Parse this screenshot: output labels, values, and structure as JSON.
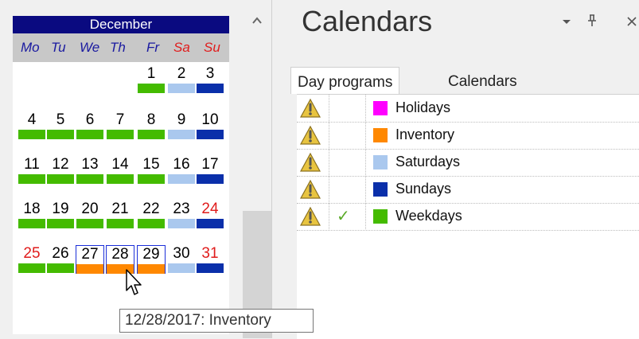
{
  "calendar": {
    "month": "December",
    "weekdays": [
      {
        "label": "Mo",
        "red": false
      },
      {
        "label": "Tu",
        "red": false
      },
      {
        "label": "We",
        "red": false
      },
      {
        "label": "Th",
        "red": false
      },
      {
        "label": "Fr",
        "red": false
      },
      {
        "label": "Sa",
        "red": true
      },
      {
        "label": "Su",
        "red": true
      }
    ],
    "days": [
      {
        "day": "1",
        "col": 4,
        "week": 0,
        "color": "#44bb00",
        "red": false,
        "selected": false
      },
      {
        "day": "2",
        "col": 5,
        "week": 0,
        "color": "#aac8ee",
        "red": false,
        "selected": false
      },
      {
        "day": "3",
        "col": 6,
        "week": 0,
        "color": "#0a2faa",
        "red": false,
        "selected": false
      },
      {
        "day": "4",
        "col": 0,
        "week": 1,
        "color": "#44bb00",
        "red": false,
        "selected": false
      },
      {
        "day": "5",
        "col": 1,
        "week": 1,
        "color": "#44bb00",
        "red": false,
        "selected": false
      },
      {
        "day": "6",
        "col": 2,
        "week": 1,
        "color": "#44bb00",
        "red": false,
        "selected": false
      },
      {
        "day": "7",
        "col": 3,
        "week": 1,
        "color": "#44bb00",
        "red": false,
        "selected": false
      },
      {
        "day": "8",
        "col": 4,
        "week": 1,
        "color": "#44bb00",
        "red": false,
        "selected": false
      },
      {
        "day": "9",
        "col": 5,
        "week": 1,
        "color": "#aac8ee",
        "red": false,
        "selected": false
      },
      {
        "day": "10",
        "col": 6,
        "week": 1,
        "color": "#0a2faa",
        "red": false,
        "selected": false
      },
      {
        "day": "11",
        "col": 0,
        "week": 2,
        "color": "#44bb00",
        "red": false,
        "selected": false
      },
      {
        "day": "12",
        "col": 1,
        "week": 2,
        "color": "#44bb00",
        "red": false,
        "selected": false
      },
      {
        "day": "13",
        "col": 2,
        "week": 2,
        "color": "#44bb00",
        "red": false,
        "selected": false
      },
      {
        "day": "14",
        "col": 3,
        "week": 2,
        "color": "#44bb00",
        "red": false,
        "selected": false
      },
      {
        "day": "15",
        "col": 4,
        "week": 2,
        "color": "#44bb00",
        "red": false,
        "selected": false
      },
      {
        "day": "16",
        "col": 5,
        "week": 2,
        "color": "#aac8ee",
        "red": false,
        "selected": false
      },
      {
        "day": "17",
        "col": 6,
        "week": 2,
        "color": "#0a2faa",
        "red": false,
        "selected": false
      },
      {
        "day": "18",
        "col": 0,
        "week": 3,
        "color": "#44bb00",
        "red": false,
        "selected": false
      },
      {
        "day": "19",
        "col": 1,
        "week": 3,
        "color": "#44bb00",
        "red": false,
        "selected": false
      },
      {
        "day": "20",
        "col": 2,
        "week": 3,
        "color": "#44bb00",
        "red": false,
        "selected": false
      },
      {
        "day": "21",
        "col": 3,
        "week": 3,
        "color": "#44bb00",
        "red": false,
        "selected": false
      },
      {
        "day": "22",
        "col": 4,
        "week": 3,
        "color": "#44bb00",
        "red": false,
        "selected": false
      },
      {
        "day": "23",
        "col": 5,
        "week": 3,
        "color": "#aac8ee",
        "red": false,
        "selected": false
      },
      {
        "day": "24",
        "col": 6,
        "week": 3,
        "color": "#0a2faa",
        "red": true,
        "selected": false
      },
      {
        "day": "25",
        "col": 0,
        "week": 4,
        "color": "#44bb00",
        "red": true,
        "selected": false
      },
      {
        "day": "26",
        "col": 1,
        "week": 4,
        "color": "#44bb00",
        "red": false,
        "selected": false
      },
      {
        "day": "27",
        "col": 2,
        "week": 4,
        "color": "#ff8800",
        "red": false,
        "selected": true
      },
      {
        "day": "28",
        "col": 3,
        "week": 4,
        "color": "#ff8800",
        "red": false,
        "selected": true
      },
      {
        "day": "29",
        "col": 4,
        "week": 4,
        "color": "#ff8800",
        "red": false,
        "selected": true
      },
      {
        "day": "30",
        "col": 5,
        "week": 4,
        "color": "#aac8ee",
        "red": false,
        "selected": false
      },
      {
        "day": "31",
        "col": 6,
        "week": 4,
        "color": "#0a2faa",
        "red": true,
        "selected": false
      }
    ]
  },
  "tooltip": "12/28/2017: Inventory",
  "panel": {
    "title": "Calendars",
    "dropdown_icon": "dropdown-arrow-icon",
    "pin_icon": "pin-icon",
    "close_icon": "close-icon"
  },
  "tabs": [
    {
      "label": "Day programs",
      "active": true
    },
    {
      "label": "Calendars",
      "active": false
    }
  ],
  "programs": [
    {
      "label": "Holidays",
      "color": "#ff00ff",
      "checked": false
    },
    {
      "label": "Inventory",
      "color": "#ff8800",
      "checked": false
    },
    {
      "label": "Saturdays",
      "color": "#aac8ee",
      "checked": false
    },
    {
      "label": "Sundays",
      "color": "#0a2faa",
      "checked": false
    },
    {
      "label": "Weekdays",
      "color": "#44bb00",
      "checked": true
    }
  ]
}
